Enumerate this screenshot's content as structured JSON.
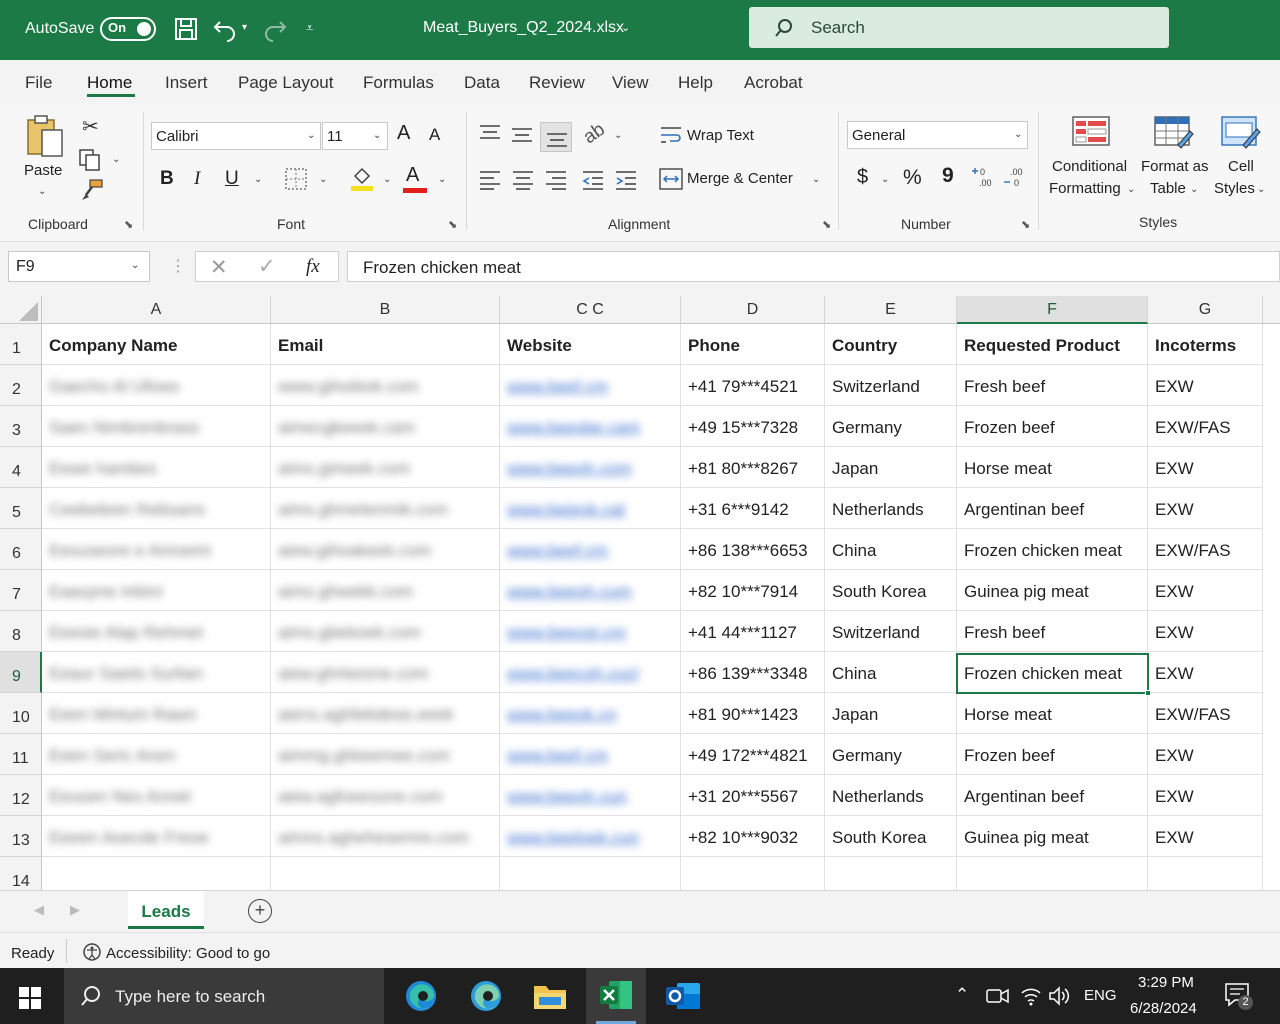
{
  "titlebar": {
    "autosave_label": "AutoSave",
    "autosave_state": "On",
    "filename": "Meat_Buyers_Q2_2024.xlsx",
    "search_label": "Search"
  },
  "tabs": [
    "File",
    "Home",
    "Insert",
    "Page Layout",
    "Formulas",
    "Data",
    "Review",
    "View",
    "Help",
    "Acrobat"
  ],
  "active_tab": "Home",
  "ribbon": {
    "clipboard": {
      "paste": "Paste",
      "label": "Clipboard"
    },
    "font": {
      "name": "Calibri",
      "size": "11",
      "label": "Font",
      "bold": "B",
      "italic": "I",
      "underline": "U",
      "grow": "A",
      "shrink": "A",
      "font_color_glyph": "A"
    },
    "alignment": {
      "wrap": "Wrap Text",
      "merge": "Merge & Center",
      "label": "Alignment"
    },
    "number": {
      "format": "General",
      "currency": "$",
      "percent": "%",
      "comma": "9",
      "label": "Number"
    },
    "styles": {
      "conditional_line1": "Conditional",
      "conditional_line2": "Formatting",
      "format_table_line1": "Format as",
      "format_table_line2": "Table",
      "cell_styles_line1": "Cell",
      "cell_styles_line2": "Styles",
      "label": "Styles"
    }
  },
  "formula_bar": {
    "name_box": "F9",
    "fx": "fx",
    "value": "Frozen chicken meat"
  },
  "sheet": {
    "columns": [
      "A",
      "B",
      "C C",
      "D",
      "E",
      "F",
      "G"
    ],
    "selected_column": "F",
    "selected_row": "9",
    "header_row": [
      "Company Name",
      "Email",
      "Website",
      "Phone",
      "Country",
      "Requested Product",
      "Incoterms"
    ],
    "rows": [
      {
        "num": "2",
        "company": "Gaecho Al Ufows",
        "email": "www.gihoibok.com",
        "website": "www.beef.cm",
        "phone": "+41 79***4521",
        "country": "Switzerland",
        "product": "Fresh beef",
        "incoterms": "EXW"
      },
      {
        "num": "3",
        "company": "Saen Nimbrenbrass",
        "email": "aimecgkeeek.cam",
        "website": "www.beesbe.cam",
        "phone": "+49 15***7328",
        "country": "Germany",
        "product": "Frozen beef",
        "incoterms": "EXW/FAS"
      },
      {
        "num": "4",
        "company": "Eewe hambes",
        "email": "aims.gimeek.com",
        "website": "www.beeoh.com",
        "phone": "+81 80***8267",
        "country": "Japan",
        "product": "Horse meat",
        "incoterms": "EXW"
      },
      {
        "num": "5",
        "company": "Ceebeleen Ihebsans",
        "email": "aims.ghmetenmik.com",
        "website": "www.bejeok.cat",
        "phone": "+31 6***9142",
        "country": "Netherlands",
        "product": "Argentinan beef",
        "incoterms": "EXW"
      },
      {
        "num": "6",
        "company": "Eesuseore e Amnemi",
        "email": "aiew.gihoakeek.com",
        "website": "www.beef.cm",
        "phone": "+86 138***6653",
        "country": "China",
        "product": "Frozen chicken meat",
        "incoterms": "EXW/FAS"
      },
      {
        "num": "7",
        "company": "Eaacpne Inbinr",
        "email": "aims.ghwekk.com",
        "website": "www.beeoh.cum",
        "phone": "+82 10***7914",
        "country": "South Korea",
        "product": "Guinea pig meat",
        "incoterms": "EXW"
      },
      {
        "num": "8",
        "company": "Eeesie Alap Rehmet",
        "email": "aims.gbeboek.com",
        "website": "www.beeost.cm",
        "phone": "+41 44***1127",
        "country": "Switzerland",
        "product": "Fresh beef",
        "incoterms": "EXW"
      },
      {
        "num": "9",
        "company": "Eeaur Saeiis Surlian",
        "email": "aiew.ghrleesne.com",
        "website": "www.beecoh.cucl",
        "phone": "+86 139***3348",
        "country": "China",
        "product": "Frozen chicken meat",
        "incoterms": "EXW"
      },
      {
        "num": "10",
        "company": "Eeen Minlum Rawn",
        "email": "aiens.aghfebdese.eeek",
        "website": "www.beeok.cn",
        "phone": "+81 90***1423",
        "country": "Japan",
        "product": "Horse meat",
        "incoterms": "EXW/FAS"
      },
      {
        "num": "11",
        "company": "Eeen Seric Anen",
        "email": "aimmg.ghkeemee.com",
        "website": "www.beef.cm",
        "phone": "+49 172***4821",
        "country": "Germany",
        "product": "Frozen beef",
        "incoterms": "EXW"
      },
      {
        "num": "12",
        "company": "Eeuoen Nes Annet",
        "email": "aiew.agfoeesone.com",
        "website": "www.beeoh.cun",
        "phone": "+31 20***5567",
        "country": "Netherlands",
        "product": "Argentinan beef",
        "incoterms": "EXW"
      },
      {
        "num": "13",
        "company": "Eeeen Aoecde Freoe",
        "email": "aimns.aghehesemre.com",
        "website": "www.beeloek.cun",
        "phone": "+82 10***9032",
        "country": "South Korea",
        "product": "Guinea pig meat",
        "incoterms": "EXW"
      }
    ],
    "last_row_num": "14",
    "active_sheet": "Leads"
  },
  "statusbar": {
    "ready": "Ready",
    "accessibility": "Accessibility: Good to go"
  },
  "taskbar": {
    "search_placeholder": "Type here to search",
    "language": "ENG",
    "time": "3:29 PM",
    "date": "6/28/2024",
    "notification_count": "2"
  },
  "colors": {
    "excel_green": "#1b7a45",
    "search_bg": "#d9ecdf",
    "taskbar": "#1f1f1f",
    "link_blue": "#3a6fd0"
  }
}
